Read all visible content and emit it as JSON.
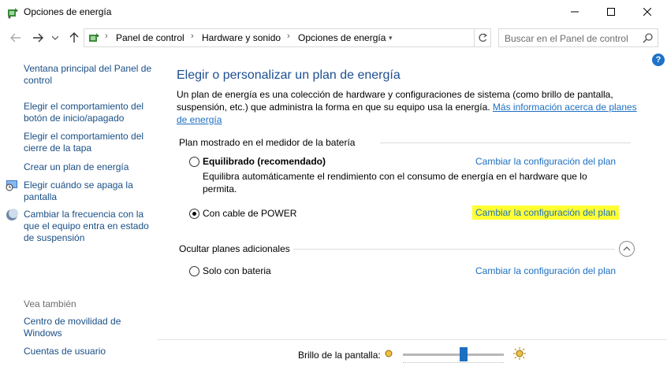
{
  "window": {
    "title": "Opciones de energía"
  },
  "nav": {
    "breadcrumbs": [
      "Panel de control",
      "Hardware y sonido",
      "Opciones de energía"
    ],
    "search_placeholder": "Buscar en el Panel de control"
  },
  "help": {
    "label": "?"
  },
  "sidebar": {
    "items": [
      {
        "label": "Ventana principal del Panel de control"
      },
      {
        "label": "Elegir el comportamiento del botón de inicio/apagado"
      },
      {
        "label": "Elegir el comportamiento del cierre de la tapa"
      },
      {
        "label": "Crear un plan de energía"
      },
      {
        "label": "Elegir cuándo se apaga la pantalla"
      },
      {
        "label": "Cambiar la frecuencia con la que el equipo entra en estado de suspensión"
      }
    ],
    "see_also_label": "Vea también",
    "see_also": [
      {
        "label": "Centro de movilidad de Windows"
      },
      {
        "label": "Cuentas de usuario"
      }
    ]
  },
  "main": {
    "title": "Elegir o personalizar un plan de energía",
    "description": "Un plan de energía es una colección de hardware y configuraciones de sistema (como brillo de pantalla, suspensión, etc.) que administra la forma en que su equipo usa la energía.",
    "more_info_link": "Más información acerca de planes de energía",
    "battery_section_label": "Plan mostrado en el medidor de la batería",
    "plans": [
      {
        "name": "Equilibrado (recomendado)",
        "description": "Equilibra automáticamente el rendimiento con el consumo de energía en el hardware que lo permita.",
        "link": "Cambiar la configuración del plan",
        "selected": false
      },
      {
        "name": "Con cable de POWER",
        "link": "Cambiar la configuración del plan",
        "selected": true
      }
    ],
    "hidden_section_label": "Ocultar planes adicionales",
    "extra_plans": [
      {
        "name": "Solo con bateria",
        "link": "Cambiar la configuración del plan",
        "selected": false
      }
    ]
  },
  "brightness": {
    "label": "Brillo de la pantalla:",
    "level_fraction": 0.6
  },
  "colors": {
    "link": "#1d6fc2",
    "nav_link": "#1a4f86",
    "title": "#1d4f91",
    "highlight": "#ffff33"
  }
}
